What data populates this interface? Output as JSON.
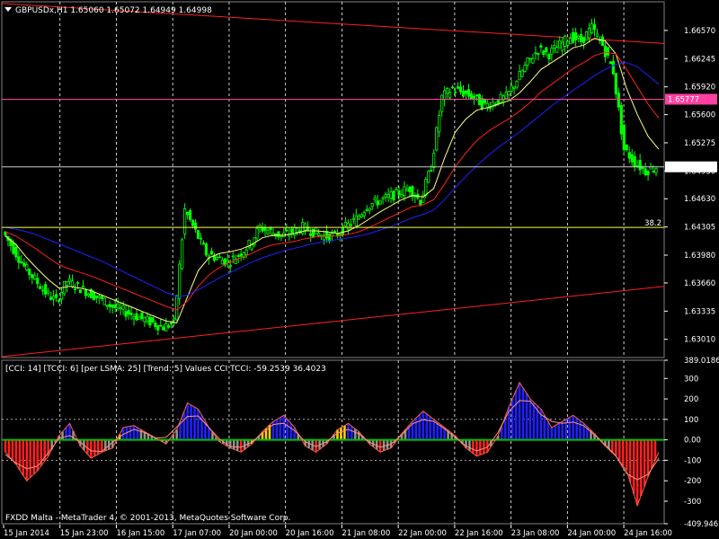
{
  "header": {
    "symbol_line": "GBPUSDx,H1  1.65060 1.65072 1.64949 1.64998"
  },
  "indicator": {
    "label": "[CCI: 14] [TCCI: 6] [per LSMA: 25] [Trend: 5] Values CCI TCCI: -59.2539 36.4023"
  },
  "footer": {
    "copyright": "FXDD Malta - MetaTrader 4, © 2001-2013, MetaQuotes Software Corp."
  },
  "colors": {
    "background": "#000000",
    "candle": "#00ff00",
    "grid": "#ffffff",
    "ma_yellow": "#ffff80",
    "ma_red": "#ff2020",
    "ma_blue": "#2020ff",
    "trendline": "#ff2020",
    "price_line": "#cccccc",
    "fib_line": "#ffff40",
    "alert_line": "#ff40a0",
    "cci_line": "#ff6040"
  },
  "chart_data": [
    {
      "type": "line",
      "title": "GBPUSDx,H1",
      "ylim": [
        1.628,
        1.669
      ],
      "price_ticks": [
        "1.66570",
        "1.66245",
        "1.65920",
        "1.65600",
        "1.65275",
        "1.64950",
        "1.64630",
        "1.64305",
        "1.63980",
        "1.63660",
        "1.63335",
        "1.63010"
      ],
      "x_labels": [
        "15 Jan 2014",
        "15 Jan 23:00",
        "16 Jan 15:00",
        "17 Jan 07:00",
        "20 Jan 00:00",
        "20 Jan 16:00",
        "21 Jan 08:00",
        "22 Jan 00:00",
        "22 Jan 16:00",
        "23 Jan 08:00",
        "24 Jan 00:00",
        "24 Jan 16:00"
      ],
      "current_price": "1.64998",
      "alert_price": "1.65777",
      "fib_label": "38.2",
      "series": [
        {
          "values": [
            1.6425,
            1.6405,
            1.6385,
            1.637,
            1.6355,
            1.6345,
            1.6368,
            1.6362,
            1.6355,
            1.6348,
            1.634,
            1.6335,
            1.633,
            1.6325,
            1.632,
            1.6315,
            1.632,
            1.645,
            1.6425,
            1.64,
            1.6395,
            1.639,
            1.6398,
            1.641,
            1.643,
            1.6425,
            1.642,
            1.6425,
            1.643,
            1.6425,
            1.642,
            1.642,
            1.643,
            1.644,
            1.6455,
            1.646,
            1.6465,
            1.647,
            1.6475,
            1.646,
            1.65,
            1.658,
            1.659,
            1.6585,
            1.658,
            1.657,
            1.6575,
            1.658,
            1.66,
            1.662,
            1.6635,
            1.663,
            1.664,
            1.665,
            1.6645,
            1.666,
            1.664,
            1.661,
            1.652,
            1.6505,
            1.6495,
            1.65
          ]
        },
        {
          "values": [
            1.642,
            1.641,
            1.6395,
            1.6382,
            1.637,
            1.636,
            1.6362,
            1.636,
            1.6357,
            1.6352,
            1.6347,
            1.6342,
            1.6337,
            1.6332,
            1.6327,
            1.6322,
            1.632,
            1.635,
            1.638,
            1.6395,
            1.64,
            1.6402,
            1.6405,
            1.641,
            1.6418,
            1.6421,
            1.6421,
            1.6423,
            1.6426,
            1.6426,
            1.6425,
            1.6423,
            1.6426,
            1.6432,
            1.644,
            1.6448,
            1.6455,
            1.6462,
            1.6467,
            1.6465,
            1.6475,
            1.651,
            1.654,
            1.6555,
            1.6565,
            1.6568,
            1.6572,
            1.6576,
            1.6585,
            1.6598,
            1.6612,
            1.662,
            1.6628,
            1.6637,
            1.664,
            1.6648,
            1.6645,
            1.663,
            1.659,
            1.656,
            1.6535,
            1.652
          ]
        },
        {
          "values": [
            1.6425,
            1.642,
            1.6412,
            1.6404,
            1.6395,
            1.6387,
            1.6382,
            1.6378,
            1.6374,
            1.6369,
            1.6364,
            1.6359,
            1.6354,
            1.6349,
            1.6344,
            1.6339,
            1.6335,
            1.6345,
            1.6362,
            1.6375,
            1.6384,
            1.639,
            1.6395,
            1.64,
            1.6406,
            1.641,
            1.6412,
            1.6414,
            1.6417,
            1.6419,
            1.642,
            1.642,
            1.6422,
            1.6425,
            1.643,
            1.6436,
            1.6442,
            1.6448,
            1.6454,
            1.6456,
            1.6462,
            1.648,
            1.65,
            1.6516,
            1.653,
            1.654,
            1.6548,
            1.6555,
            1.6564,
            1.6574,
            1.6586,
            1.6595,
            1.6604,
            1.6613,
            1.662,
            1.6628,
            1.6632,
            1.663,
            1.6612,
            1.6592,
            1.6572,
            1.6556
          ]
        },
        {
          "values": [
            1.643,
            1.6428,
            1.6425,
            1.6421,
            1.6416,
            1.6411,
            1.6406,
            1.6401,
            1.6396,
            1.6391,
            1.6385,
            1.6379,
            1.6373,
            1.6367,
            1.6361,
            1.6355,
            1.635,
            1.6352,
            1.6358,
            1.6365,
            1.6372,
            1.6378,
            1.6384,
            1.639,
            1.6395,
            1.6399,
            1.6403,
            1.6406,
            1.6409,
            1.6412,
            1.6414,
            1.6416,
            1.6418,
            1.642,
            1.6423,
            1.6427,
            1.6431,
            1.6436,
            1.6441,
            1.6445,
            1.645,
            1.6462,
            1.6476,
            1.6489,
            1.6501,
            1.6512,
            1.6522,
            1.6531,
            1.654,
            1.655,
            1.656,
            1.657,
            1.6579,
            1.6588,
            1.6596,
            1.6605,
            1.6612,
            1.6618,
            1.662,
            1.6615,
            1.6605,
            1.6595
          ]
        }
      ]
    },
    {
      "type": "bar",
      "title": "[CCI: 14] [TCCI: 6] [per LSMA: 25] [Trend: 5] Values CCI TCCI: -59.2539 36.4023",
      "ylim": [
        -409.9461,
        389.0186
      ],
      "cci_ticks": [
        "389.0186",
        "300",
        "200",
        "100",
        "0.00",
        "-100",
        "-200",
        "-300",
        "-409.9461"
      ],
      "values": [
        -60,
        -120,
        -200,
        -150,
        -80,
        20,
        80,
        -30,
        -90,
        -60,
        -40,
        60,
        70,
        40,
        10,
        -20,
        50,
        180,
        150,
        60,
        -10,
        -40,
        -60,
        -20,
        40,
        90,
        120,
        60,
        -30,
        -60,
        -20,
        50,
        80,
        40,
        -20,
        -60,
        -40,
        30,
        90,
        140,
        100,
        60,
        20,
        -40,
        -80,
        -60,
        20,
        160,
        280,
        200,
        150,
        60,
        90,
        120,
        80,
        30,
        -30,
        -80,
        -150,
        -320,
        -180,
        -60
      ]
    }
  ]
}
